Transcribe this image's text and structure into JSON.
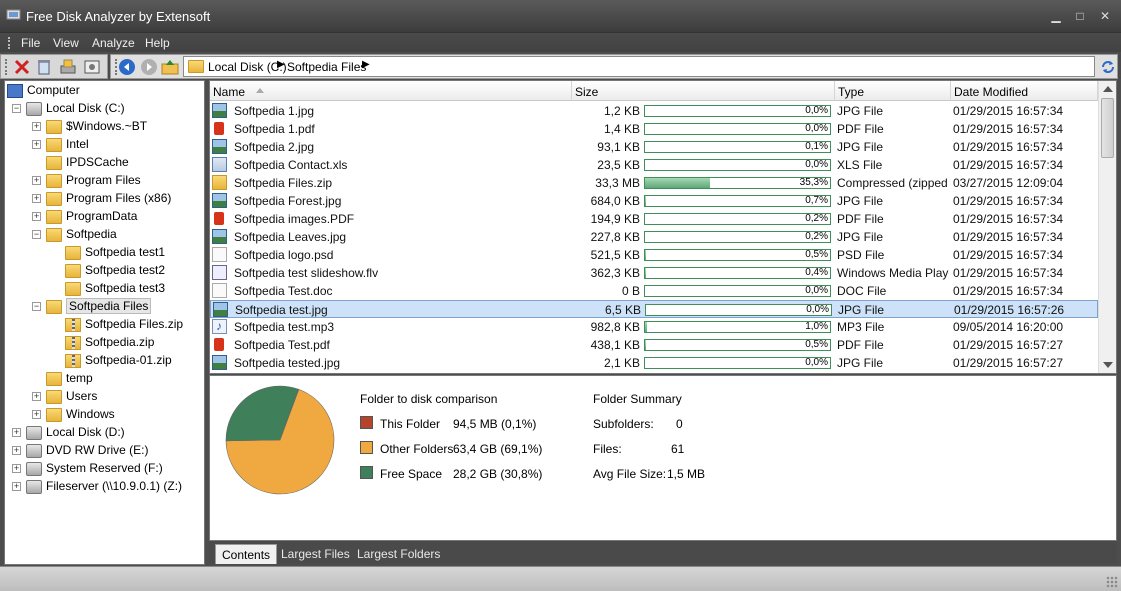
{
  "window": {
    "title": "Free Disk Analyzer by Extensoft"
  },
  "menu": [
    "File",
    "View",
    "Analyze",
    "Help"
  ],
  "address": {
    "crumbs": [
      "Local Disk (C:)",
      "Softpedia Files"
    ]
  },
  "tree": [
    {
      "label": "Computer",
      "level": 0,
      "exp": "",
      "icon": "computer"
    },
    {
      "label": "Local Disk (C:)",
      "level": 1,
      "exp": "-",
      "icon": "drive"
    },
    {
      "label": "$Windows.~BT",
      "level": 2,
      "exp": "+",
      "icon": "folder"
    },
    {
      "label": "Intel",
      "level": 2,
      "exp": "+",
      "icon": "folder"
    },
    {
      "label": "IPDSCache",
      "level": 2,
      "exp": "",
      "icon": "folder"
    },
    {
      "label": "Program Files",
      "level": 2,
      "exp": "+",
      "icon": "folder"
    },
    {
      "label": "Program Files (x86)",
      "level": 2,
      "exp": "+",
      "icon": "folder"
    },
    {
      "label": "ProgramData",
      "level": 2,
      "exp": "+",
      "icon": "folder"
    },
    {
      "label": "Softpedia",
      "level": 2,
      "exp": "-",
      "icon": "folder"
    },
    {
      "label": "Softpedia test1",
      "level": 3,
      "exp": "",
      "icon": "folder"
    },
    {
      "label": "Softpedia test2",
      "level": 3,
      "exp": "",
      "icon": "folder"
    },
    {
      "label": "Softpedia test3",
      "level": 3,
      "exp": "",
      "icon": "folder"
    },
    {
      "label": "Softpedia Files",
      "level": 2,
      "exp": "-",
      "icon": "folder",
      "selected": true
    },
    {
      "label": "Softpedia Files.zip",
      "level": 3,
      "exp": "",
      "icon": "zip"
    },
    {
      "label": "Softpedia.zip",
      "level": 3,
      "exp": "",
      "icon": "zip"
    },
    {
      "label": "Softpedia-01.zip",
      "level": 3,
      "exp": "",
      "icon": "zip"
    },
    {
      "label": "temp",
      "level": 2,
      "exp": "",
      "icon": "folder"
    },
    {
      "label": "Users",
      "level": 2,
      "exp": "+",
      "icon": "folder"
    },
    {
      "label": "Windows",
      "level": 2,
      "exp": "+",
      "icon": "folder"
    },
    {
      "label": "Local Disk (D:)",
      "level": 1,
      "exp": "+",
      "icon": "drive"
    },
    {
      "label": "DVD RW Drive (E:)",
      "level": 1,
      "exp": "+",
      "icon": "drive"
    },
    {
      "label": "System Reserved (F:)",
      "level": 1,
      "exp": "+",
      "icon": "drive"
    },
    {
      "label": "Fileserver (\\\\10.9.0.1) (Z:)",
      "level": 1,
      "exp": "+",
      "icon": "netdrive"
    }
  ],
  "columns": {
    "name": "Name",
    "size": "Size",
    "type": "Type",
    "date": "Date Modified"
  },
  "files": [
    {
      "name": "Softpedia 1.jpg",
      "size": "1,2 KB",
      "pct": 0.0,
      "pct_label": "0,0%",
      "type": "JPG File",
      "date": "01/29/2015 16:57:34",
      "icon": "jpg"
    },
    {
      "name": "Softpedia 1.pdf",
      "size": "1,4 KB",
      "pct": 0.0,
      "pct_label": "0,0%",
      "type": "PDF File",
      "date": "01/29/2015 16:57:34",
      "icon": "pdf"
    },
    {
      "name": "Softpedia 2.jpg",
      "size": "93,1 KB",
      "pct": 0.1,
      "pct_label": "0,1%",
      "type": "JPG File",
      "date": "01/29/2015 16:57:34",
      "icon": "jpg"
    },
    {
      "name": "Softpedia Contact.xls",
      "size": "23,5 KB",
      "pct": 0.0,
      "pct_label": "0,0%",
      "type": "XLS File",
      "date": "01/29/2015 16:57:34",
      "icon": "xls"
    },
    {
      "name": "Softpedia Files.zip",
      "size": "33,3 MB",
      "pct": 35.3,
      "pct_label": "35,3%",
      "type": "Compressed (zipped…",
      "date": "03/27/2015 12:09:04",
      "icon": "zip"
    },
    {
      "name": "Softpedia Forest.jpg",
      "size": "684,0 KB",
      "pct": 0.7,
      "pct_label": "0,7%",
      "type": "JPG File",
      "date": "01/29/2015 16:57:34",
      "icon": "jpg"
    },
    {
      "name": "Softpedia images.PDF",
      "size": "194,9 KB",
      "pct": 0.2,
      "pct_label": "0,2%",
      "type": "PDF File",
      "date": "01/29/2015 16:57:34",
      "icon": "pdf"
    },
    {
      "name": "Softpedia Leaves.jpg",
      "size": "227,8 KB",
      "pct": 0.2,
      "pct_label": "0,2%",
      "type": "JPG File",
      "date": "01/29/2015 16:57:34",
      "icon": "jpg"
    },
    {
      "name": "Softpedia logo.psd",
      "size": "521,5 KB",
      "pct": 0.5,
      "pct_label": "0,5%",
      "type": "PSD File",
      "date": "01/29/2015 16:57:34",
      "icon": "psd"
    },
    {
      "name": "Softpedia test slideshow.flv",
      "size": "362,3 KB",
      "pct": 0.4,
      "pct_label": "0,4%",
      "type": "Windows Media Player",
      "date": "01/29/2015 16:57:34",
      "icon": "flv"
    },
    {
      "name": "Softpedia Test.doc",
      "size": "0 B",
      "pct": 0.0,
      "pct_label": "0,0%",
      "type": "DOC File",
      "date": "01/29/2015 16:57:34",
      "icon": "doc"
    },
    {
      "name": "Softpedia test.jpg",
      "size": "6,5 KB",
      "pct": 0.0,
      "pct_label": "0,0%",
      "type": "JPG File",
      "date": "01/29/2015 16:57:26",
      "icon": "jpg",
      "selected": true
    },
    {
      "name": "Softpedia test.mp3",
      "size": "982,8 KB",
      "pct": 1.0,
      "pct_label": "1,0%",
      "type": "MP3 File",
      "date": "09/05/2014 16:20:00",
      "icon": "mp3"
    },
    {
      "name": "Softpedia Test.pdf",
      "size": "438,1 KB",
      "pct": 0.5,
      "pct_label": "0,5%",
      "type": "PDF File",
      "date": "01/29/2015 16:57:27",
      "icon": "pdf"
    },
    {
      "name": "Softpedia tested.jpg",
      "size": "2,1 KB",
      "pct": 0.0,
      "pct_label": "0,0%",
      "type": "JPG File",
      "date": "01/29/2015 16:57:27",
      "icon": "jpg"
    }
  ],
  "comparison": {
    "heading": "Folder to disk comparison",
    "items": [
      {
        "label": "This Folder",
        "value": "94,5 MB (0,1%)",
        "color": "#b5452a",
        "fraction": 0.001
      },
      {
        "label": "Other Folders",
        "value": "63,4 GB (69,1%)",
        "color": "#f0a840",
        "fraction": 0.691
      },
      {
        "label": "Free Space",
        "value": "28,2 GB (30,8%)",
        "color": "#3f7f5a",
        "fraction": 0.308
      }
    ]
  },
  "summary": {
    "heading": "Folder Summary",
    "items": [
      {
        "label": "Subfolders:",
        "value": "0"
      },
      {
        "label": "Files:",
        "value": "61"
      },
      {
        "label": "Avg File Size:",
        "value": "1,5 MB"
      }
    ]
  },
  "tabs": [
    "Contents",
    "Largest Files",
    "Largest Folders"
  ]
}
